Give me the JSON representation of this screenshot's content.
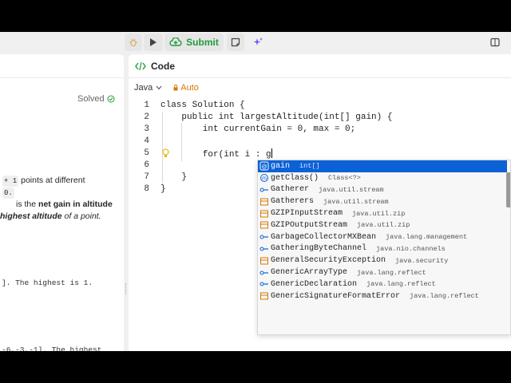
{
  "toolbar": {
    "submit_label": "Submit"
  },
  "description": {
    "solved_label": "Solved",
    "chip_plus_one": "+ 1",
    "line1_text": "points at different",
    "chip_zero": "0.",
    "line2_pre": "is the",
    "line2_bold": "net gain in altitude",
    "line3_bold_italic": "highest altitude",
    "line3_rest": "of a point.",
    "example1": "]. The highest is 1.",
    "example2": "-6,-3,-1]. The highest"
  },
  "code_panel": {
    "title": "Code",
    "language": "Java",
    "auto_label": "Auto"
  },
  "editor": {
    "line_numbers": [
      "1",
      "2",
      "3",
      "4",
      "5",
      "6",
      "7",
      "8"
    ],
    "lines": [
      "class Solution {",
      "    public int largestAltitude(int[] gain) {",
      "        int currentGain = 0, max = 0;",
      "",
      "        for(int i : g",
      "",
      "    }",
      "}"
    ]
  },
  "autocomplete": {
    "items": [
      {
        "name": "gain",
        "detail": "int[]",
        "icon": "variable-icon"
      },
      {
        "name": "getClass()",
        "detail": "Class<?>",
        "icon": "method-icon"
      },
      {
        "name": "Gatherer",
        "detail": "java.util.stream",
        "icon": "interface-icon"
      },
      {
        "name": "Gatherers",
        "detail": "java.util.stream",
        "icon": "class-icon"
      },
      {
        "name": "GZIPInputStream",
        "detail": "java.util.zip",
        "icon": "class-icon"
      },
      {
        "name": "GZIPOutputStream",
        "detail": "java.util.zip",
        "icon": "class-icon"
      },
      {
        "name": "GarbageCollectorMXBean",
        "detail": "java.lang.management",
        "icon": "interface-icon"
      },
      {
        "name": "GatheringByteChannel",
        "detail": "java.nio.channels",
        "icon": "interface-icon"
      },
      {
        "name": "GeneralSecurityException",
        "detail": "java.security",
        "icon": "class-icon"
      },
      {
        "name": "GenericArrayType",
        "detail": "java.lang.reflect",
        "icon": "interface-icon"
      },
      {
        "name": "GenericDeclaration",
        "detail": "java.lang.reflect",
        "icon": "interface-icon"
      },
      {
        "name": "GenericSignatureFormatError",
        "detail": "java.lang.reflect",
        "icon": "class-icon"
      }
    ]
  },
  "colors": {
    "submit_green": "#1f9d3e",
    "auto_orange": "#d97706",
    "selection_blue": "#0b62d6",
    "keyword_blue": "#0b46a8"
  }
}
